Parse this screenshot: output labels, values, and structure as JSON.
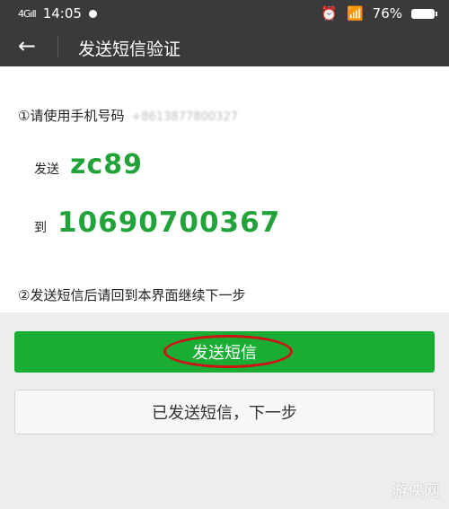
{
  "status_bar": {
    "signal": "4Gıll",
    "time": "14:05",
    "battery": "76%"
  },
  "nav": {
    "back_icon": "←",
    "title": "发送短信验证"
  },
  "content": {
    "step1": "①请使用手机号码",
    "phone_masked": "+8613877800327",
    "send_label": "发送",
    "code": "zc89",
    "to_label": "到",
    "number": "10690700367",
    "step2": "②发送短信后请回到本界面继续下一步"
  },
  "buttons": {
    "send_sms": "发送短信",
    "sent_next": "已发送短信，下一步"
  },
  "watermark": "游侠网",
  "colors": {
    "accent": "#1aad34",
    "highlight": "#d10f14"
  }
}
